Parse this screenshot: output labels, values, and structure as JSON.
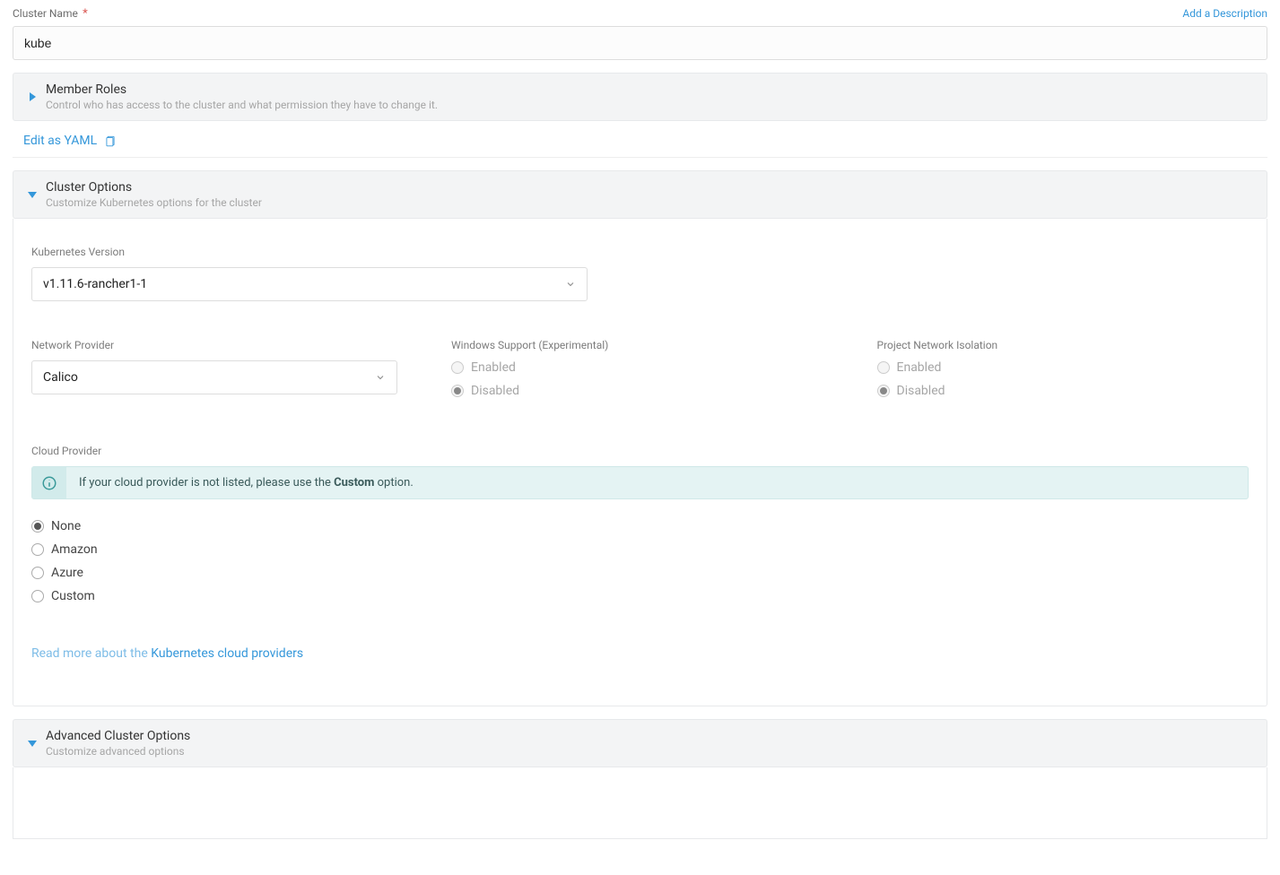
{
  "topLink": "Add a Description",
  "clusterName": {
    "label": "Cluster Name",
    "value": "kube"
  },
  "memberRoles": {
    "title": "Member Roles",
    "subtitle": "Control who has access to the cluster and what permission they have to change it."
  },
  "editYaml": "Edit as YAML",
  "clusterOptions": {
    "title": "Cluster Options",
    "subtitle": "Customize Kubernetes options for the cluster"
  },
  "k8sVersion": {
    "label": "Kubernetes Version",
    "value": "v1.11.6-rancher1-1"
  },
  "networkProvider": {
    "label": "Network Provider",
    "value": "Calico"
  },
  "windowsSupport": {
    "label": "Windows Support (Experimental)",
    "enabled": "Enabled",
    "disabled": "Disabled"
  },
  "projectIsolation": {
    "label": "Project Network Isolation",
    "enabled": "Enabled",
    "disabled": "Disabled"
  },
  "cloudProvider": {
    "label": "Cloud Provider",
    "infoPrefix": "If your cloud provider is not listed, please use the ",
    "infoBold": "Custom",
    "infoSuffix": " option.",
    "options": {
      "none": "None",
      "amazon": "Amazon",
      "azure": "Azure",
      "custom": "Custom"
    },
    "readMorePre": "Read more about the ",
    "readMoreLink": "Kubernetes cloud providers"
  },
  "advanced": {
    "title": "Advanced Cluster Options",
    "subtitle": "Customize advanced options"
  }
}
